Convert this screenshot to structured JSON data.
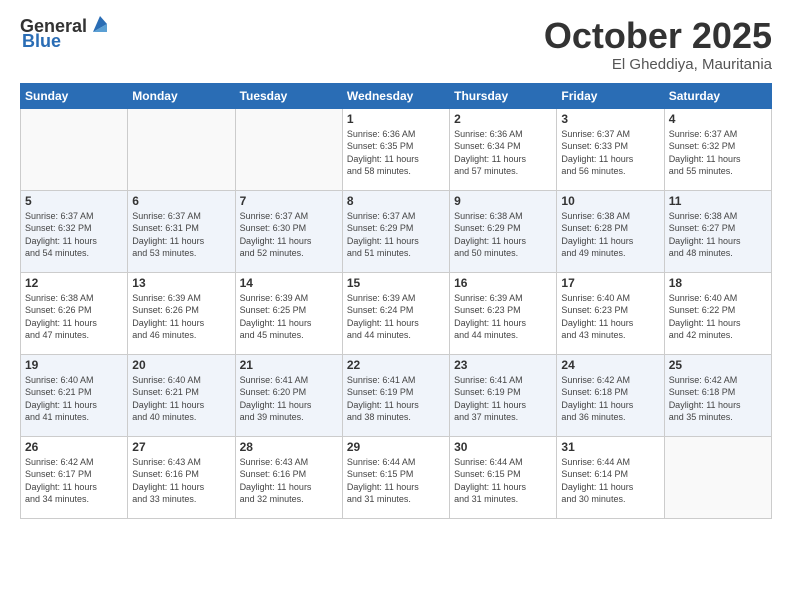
{
  "header": {
    "logo_general": "General",
    "logo_blue": "Blue",
    "title": "October 2025",
    "location": "El Gheddiya, Mauritania"
  },
  "days_of_week": [
    "Sunday",
    "Monday",
    "Tuesday",
    "Wednesday",
    "Thursday",
    "Friday",
    "Saturday"
  ],
  "weeks": [
    [
      {
        "day": "",
        "info": ""
      },
      {
        "day": "",
        "info": ""
      },
      {
        "day": "",
        "info": ""
      },
      {
        "day": "1",
        "info": "Sunrise: 6:36 AM\nSunset: 6:35 PM\nDaylight: 11 hours\nand 58 minutes."
      },
      {
        "day": "2",
        "info": "Sunrise: 6:36 AM\nSunset: 6:34 PM\nDaylight: 11 hours\nand 57 minutes."
      },
      {
        "day": "3",
        "info": "Sunrise: 6:37 AM\nSunset: 6:33 PM\nDaylight: 11 hours\nand 56 minutes."
      },
      {
        "day": "4",
        "info": "Sunrise: 6:37 AM\nSunset: 6:32 PM\nDaylight: 11 hours\nand 55 minutes."
      }
    ],
    [
      {
        "day": "5",
        "info": "Sunrise: 6:37 AM\nSunset: 6:32 PM\nDaylight: 11 hours\nand 54 minutes."
      },
      {
        "day": "6",
        "info": "Sunrise: 6:37 AM\nSunset: 6:31 PM\nDaylight: 11 hours\nand 53 minutes."
      },
      {
        "day": "7",
        "info": "Sunrise: 6:37 AM\nSunset: 6:30 PM\nDaylight: 11 hours\nand 52 minutes."
      },
      {
        "day": "8",
        "info": "Sunrise: 6:37 AM\nSunset: 6:29 PM\nDaylight: 11 hours\nand 51 minutes."
      },
      {
        "day": "9",
        "info": "Sunrise: 6:38 AM\nSunset: 6:29 PM\nDaylight: 11 hours\nand 50 minutes."
      },
      {
        "day": "10",
        "info": "Sunrise: 6:38 AM\nSunset: 6:28 PM\nDaylight: 11 hours\nand 49 minutes."
      },
      {
        "day": "11",
        "info": "Sunrise: 6:38 AM\nSunset: 6:27 PM\nDaylight: 11 hours\nand 48 minutes."
      }
    ],
    [
      {
        "day": "12",
        "info": "Sunrise: 6:38 AM\nSunset: 6:26 PM\nDaylight: 11 hours\nand 47 minutes."
      },
      {
        "day": "13",
        "info": "Sunrise: 6:39 AM\nSunset: 6:26 PM\nDaylight: 11 hours\nand 46 minutes."
      },
      {
        "day": "14",
        "info": "Sunrise: 6:39 AM\nSunset: 6:25 PM\nDaylight: 11 hours\nand 45 minutes."
      },
      {
        "day": "15",
        "info": "Sunrise: 6:39 AM\nSunset: 6:24 PM\nDaylight: 11 hours\nand 44 minutes."
      },
      {
        "day": "16",
        "info": "Sunrise: 6:39 AM\nSunset: 6:23 PM\nDaylight: 11 hours\nand 44 minutes."
      },
      {
        "day": "17",
        "info": "Sunrise: 6:40 AM\nSunset: 6:23 PM\nDaylight: 11 hours\nand 43 minutes."
      },
      {
        "day": "18",
        "info": "Sunrise: 6:40 AM\nSunset: 6:22 PM\nDaylight: 11 hours\nand 42 minutes."
      }
    ],
    [
      {
        "day": "19",
        "info": "Sunrise: 6:40 AM\nSunset: 6:21 PM\nDaylight: 11 hours\nand 41 minutes."
      },
      {
        "day": "20",
        "info": "Sunrise: 6:40 AM\nSunset: 6:21 PM\nDaylight: 11 hours\nand 40 minutes."
      },
      {
        "day": "21",
        "info": "Sunrise: 6:41 AM\nSunset: 6:20 PM\nDaylight: 11 hours\nand 39 minutes."
      },
      {
        "day": "22",
        "info": "Sunrise: 6:41 AM\nSunset: 6:19 PM\nDaylight: 11 hours\nand 38 minutes."
      },
      {
        "day": "23",
        "info": "Sunrise: 6:41 AM\nSunset: 6:19 PM\nDaylight: 11 hours\nand 37 minutes."
      },
      {
        "day": "24",
        "info": "Sunrise: 6:42 AM\nSunset: 6:18 PM\nDaylight: 11 hours\nand 36 minutes."
      },
      {
        "day": "25",
        "info": "Sunrise: 6:42 AM\nSunset: 6:18 PM\nDaylight: 11 hours\nand 35 minutes."
      }
    ],
    [
      {
        "day": "26",
        "info": "Sunrise: 6:42 AM\nSunset: 6:17 PM\nDaylight: 11 hours\nand 34 minutes."
      },
      {
        "day": "27",
        "info": "Sunrise: 6:43 AM\nSunset: 6:16 PM\nDaylight: 11 hours\nand 33 minutes."
      },
      {
        "day": "28",
        "info": "Sunrise: 6:43 AM\nSunset: 6:16 PM\nDaylight: 11 hours\nand 32 minutes."
      },
      {
        "day": "29",
        "info": "Sunrise: 6:44 AM\nSunset: 6:15 PM\nDaylight: 11 hours\nand 31 minutes."
      },
      {
        "day": "30",
        "info": "Sunrise: 6:44 AM\nSunset: 6:15 PM\nDaylight: 11 hours\nand 31 minutes."
      },
      {
        "day": "31",
        "info": "Sunrise: 6:44 AM\nSunset: 6:14 PM\nDaylight: 11 hours\nand 30 minutes."
      },
      {
        "day": "",
        "info": ""
      }
    ]
  ]
}
